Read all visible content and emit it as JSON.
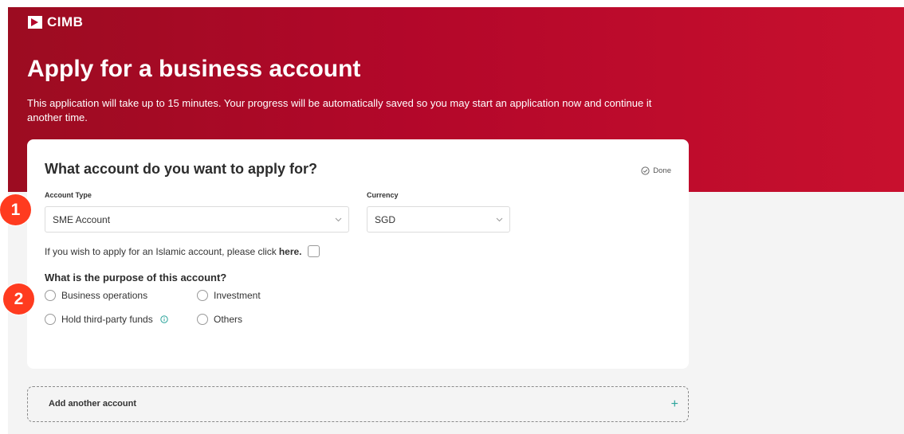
{
  "brand": {
    "name": "CIMB"
  },
  "hero": {
    "title": "Apply for a business account",
    "description": "This application will take up to 15 minutes. Your progress will be automatically saved so you may start an application now and continue it another time."
  },
  "card": {
    "title": "What account do you want to apply for?",
    "status": "Done",
    "account_type": {
      "label": "Account Type",
      "value": "SME Account"
    },
    "currency": {
      "label": "Currency",
      "value": "SGD"
    },
    "islamic": {
      "text": "If you wish to apply for an Islamic account, please click",
      "link": "here."
    },
    "purpose": {
      "question": "What is the purpose of this account?",
      "options": [
        "Business operations",
        "Investment",
        "Hold third-party funds",
        "Others"
      ]
    }
  },
  "add_account": {
    "label": "Add another account",
    "icon": "plus"
  },
  "steps": [
    "1",
    "2"
  ],
  "colors": {
    "brand_red": "#c8102e",
    "accent_teal": "#2aa39a",
    "step_badge": "#ff3b1f"
  }
}
